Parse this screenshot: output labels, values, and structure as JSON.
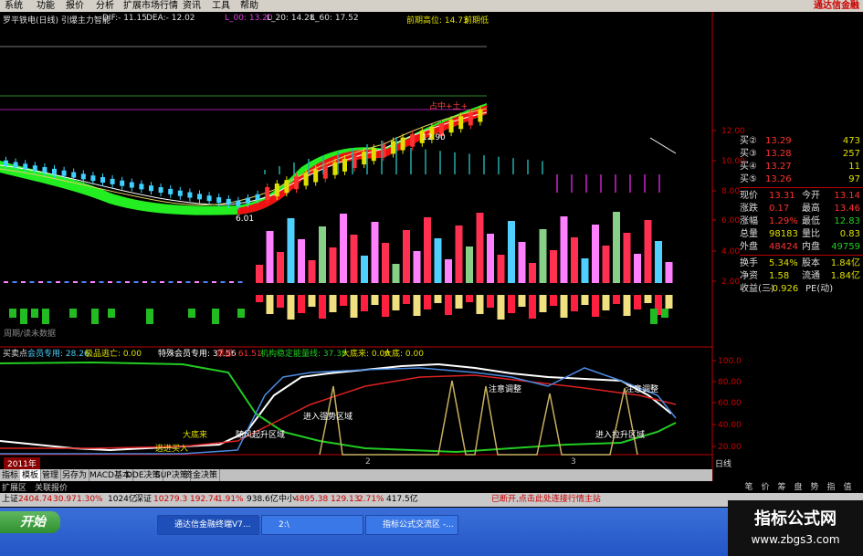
{
  "menu": {
    "items": [
      "系统",
      "功能",
      "报价",
      "分析",
      "扩展市场行情",
      "资讯",
      "工具",
      "帮助"
    ],
    "brand": "通达信金融"
  },
  "legend1": {
    "title": "罗平铁电(日线) 引爆主力智能",
    "dif": "DIF:- 11.15",
    "dea": "DEA:- 12.02",
    "l5": "L_00: 13.20",
    "l20": "L_20: 14.28",
    "l60": "L_60: 17.52",
    "prev_high": "前期高位: 14.73",
    "prev_low": "前期低"
  },
  "annotations": {
    "low_price": "6.01",
    "high_mark": "12.90",
    "buy_signals": "占中+土+",
    "weekly_tag": "周期/读未数据"
  },
  "legend2": {
    "name": "买卖点",
    "member": "会员专用: 28.26",
    "escape": "极品逃亡: 0.00",
    "special": "特殊会员专用: 37.56",
    "top": "顶部: 61.51",
    "inst": "机构稳定能量线: 37.38",
    "bottom_big": "大底来: 0.00",
    "big": "大底: 0.00"
  },
  "chart_labels": {
    "big_bottom": "大底来",
    "escape": "逃进买入",
    "rise": "随风起升区域",
    "enter_strong": "进入强势区域",
    "pull_back": "注意调整",
    "pull_back2": "注意调整",
    "enter_rise": "进入拉升区域",
    "year": "2011年",
    "m2": "2",
    "m3": "3"
  },
  "price_axis": [
    "12.00",
    "10.00",
    "8.00",
    "6.00",
    "4.00",
    "2.00"
  ],
  "osc_axis": [
    "100.0",
    "80.00",
    "60.00",
    "40.00",
    "20.00"
  ],
  "quote": {
    "rows": [
      {
        "k": "买②",
        "v": "13.29",
        "q": "473"
      },
      {
        "k": "买③",
        "v": "13.28",
        "q": "257"
      },
      {
        "k": "买④",
        "v": "13.27",
        "q": "11"
      },
      {
        "k": "买⑤",
        "v": "13.26",
        "q": "97"
      }
    ],
    "stats": [
      {
        "k": "现价",
        "v": "13.31",
        "k2": "今开",
        "v2": "13.14"
      },
      {
        "k": "涨跌",
        "v": "0.17",
        "k2": "最高",
        "v2": "13.46"
      },
      {
        "k": "涨幅",
        "v": "1.29%",
        "k2": "最低",
        "v2": "12.83"
      },
      {
        "k": "总量",
        "v": "98183",
        "k2": "量比",
        "v2": "0.83"
      },
      {
        "k": "外盘",
        "v": "48424",
        "k2": "内盘",
        "v2": "49759"
      }
    ],
    "stats2": [
      {
        "k": "换手",
        "v": "5.34%",
        "k2": "股本",
        "v2": "1.84亿"
      },
      {
        "k": "净资",
        "v": "1.58",
        "k2": "流通",
        "v2": "1.84亿"
      },
      {
        "k": "收益(三)",
        "v": "-0.926",
        "k2": "PE(动)",
        "v2": ""
      }
    ]
  },
  "tabs": [
    "指标",
    "模板",
    "管理",
    "另存为",
    "MACD基本",
    "DDE决策",
    "SUP决策",
    "资金决策"
  ],
  "subtabs": [
    "扩展区",
    "关联报价"
  ],
  "right_tab": "日线",
  "vtabs": [
    "笔",
    "价",
    "筹",
    "盘",
    "势",
    "指",
    "值"
  ],
  "status": {
    "sh_label": "上证",
    "sh_val": "2404.74",
    "sh_chg": "30.97",
    "sh_pct": "1.30%",
    "sh_amt": "1024亿",
    "sz_label": "深证",
    "sz_val": "10279.3",
    "sz_chg": "192.74",
    "sz_pct": "1.91%",
    "sz_amt": "938.6亿",
    "zx_label": "中小",
    "zx_val": "4895.38",
    "zx_chg": "129.13",
    "zx_pct": "2.71%",
    "zx_amt": "417.5亿",
    "msg": "已断开,点击此处连接行情主站"
  },
  "taskbar": {
    "start": "开始",
    "tasks": [
      "通达信金融终端V7...",
      "2:\\",
      "指标公式交流区 -..."
    ]
  },
  "watermark": {
    "line1": "指标公式网",
    "line2": "www.zbgs3.com"
  }
}
